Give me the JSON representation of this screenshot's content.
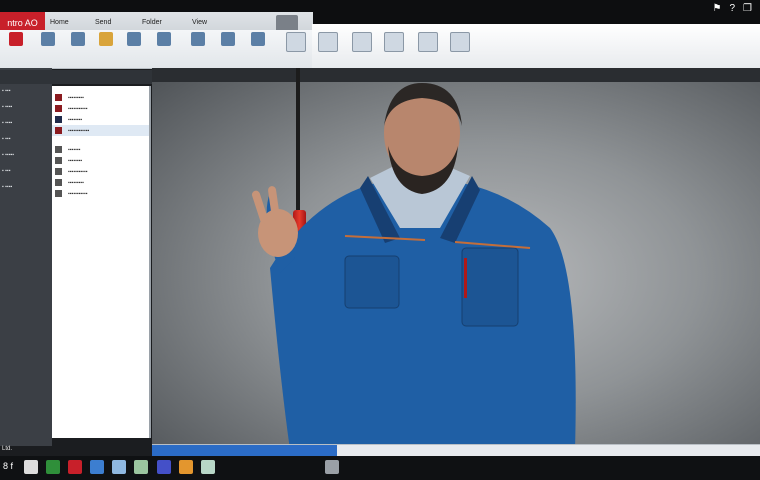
{
  "brand": {
    "label": "ntro AO"
  },
  "menu": {
    "tabs": [
      "Home",
      "Send",
      "Folder",
      "View"
    ]
  },
  "status": {
    "left_text": "Ltd."
  },
  "taskbar": {
    "start_label": "8 f"
  },
  "colors": {
    "brand": "#c8202a",
    "accent": "#2b6cc6",
    "jacket": "#1f5fa5",
    "tool": "#d92c22"
  }
}
